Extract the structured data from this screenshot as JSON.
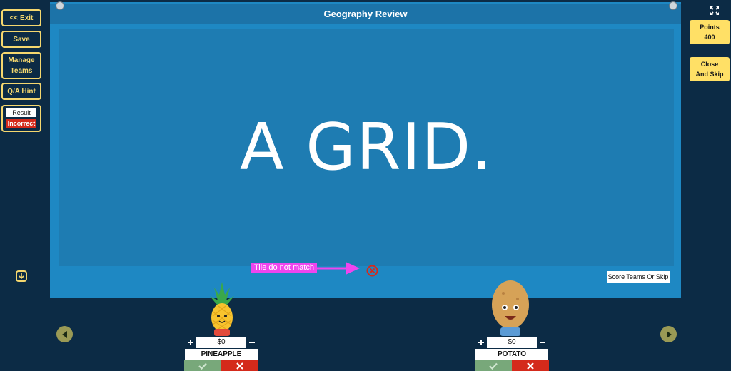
{
  "left_toolbar": {
    "exit_label": "<< Exit",
    "save_label": "Save",
    "manage_teams_label": "Manage Teams",
    "qa_hint_label": "Q/A Hint",
    "result_label": "Result",
    "result_value": "Incorrect"
  },
  "board": {
    "title": "Geography Review",
    "answer_text": "A GRID."
  },
  "annotation": {
    "text": "Tile do not match"
  },
  "score_teams_label": "Score Teams Or Skip",
  "right_toolbar": {
    "points_label": "Points",
    "points_value": "400",
    "close_skip_label": "Close And Skip"
  },
  "teams": [
    {
      "name": "PINEAPPLE",
      "score": "$0"
    },
    {
      "name": "POTATO",
      "score": "$0"
    }
  ],
  "colors": {
    "background": "#0c2b45",
    "board": "#1e88c3",
    "accent": "#f5d76e",
    "button_yellow": "#ffe066",
    "incorrect": "#d42a1b",
    "annotation": "#ef45ee"
  }
}
